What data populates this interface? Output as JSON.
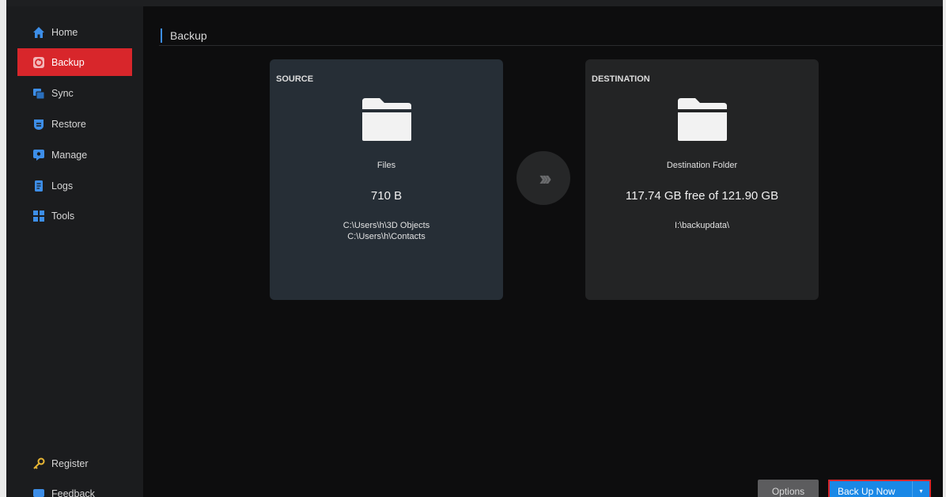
{
  "sidebar": {
    "items": [
      {
        "label": "Home",
        "icon": "home-icon",
        "active": false
      },
      {
        "label": "Backup",
        "icon": "backup-icon",
        "active": true
      },
      {
        "label": "Sync",
        "icon": "sync-icon",
        "active": false
      },
      {
        "label": "Restore",
        "icon": "restore-icon",
        "active": false
      },
      {
        "label": "Manage",
        "icon": "manage-icon",
        "active": false
      },
      {
        "label": "Logs",
        "icon": "logs-icon",
        "active": false
      },
      {
        "label": "Tools",
        "icon": "tools-icon",
        "active": false
      }
    ],
    "bottom_items": [
      {
        "label": "Register",
        "icon": "key-icon"
      },
      {
        "label": "Feedback",
        "icon": "feedback-icon"
      }
    ]
  },
  "main": {
    "title": "Backup",
    "source": {
      "label": "SOURCE",
      "name": "Files",
      "size": "710 B",
      "paths": [
        "C:\\Users\\h\\3D Objects",
        "C:\\Users\\h\\Contacts"
      ]
    },
    "destination": {
      "label": "DESTINATION",
      "name": "Destination Folder",
      "size": "117.74 GB free of 121.90 GB",
      "path": "I:\\backupdata\\"
    },
    "arrow_glyph": "›››"
  },
  "footer": {
    "options_label": "Options",
    "backup_now_label": "Back Up Now",
    "caret": "▾"
  },
  "colors": {
    "accent_red": "#d8262b",
    "accent_blue": "#1a88e6",
    "title_bar_blue": "#3d8ee8",
    "background": "#0d0d0e",
    "sidebar": "#1b1c1e"
  }
}
